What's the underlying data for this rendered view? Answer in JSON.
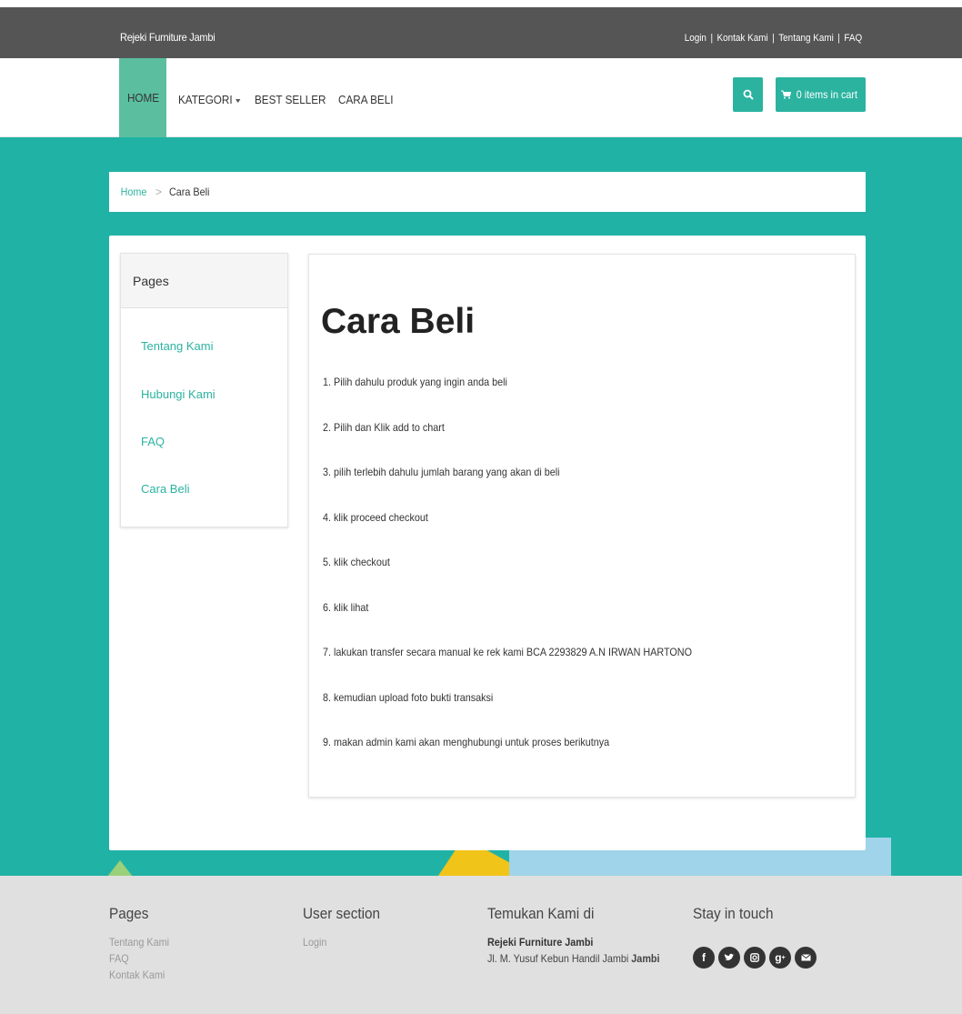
{
  "topbar": {
    "brand": "Rejeki Furniture Jambi",
    "links": [
      "Login",
      "Kontak Kami",
      "Tentang Kami",
      "FAQ"
    ]
  },
  "nav": {
    "items": [
      "HOME",
      "KATEGORI",
      "BEST SELLER",
      "CARA BELI"
    ],
    "cart_label": "0 items in cart"
  },
  "breadcrumb": {
    "home": "Home",
    "separator": ">",
    "current": "Cara Beli"
  },
  "sidebar": {
    "title": "Pages",
    "items": [
      "Tentang Kami",
      "Hubungi Kami",
      "FAQ",
      "Cara Beli"
    ]
  },
  "content": {
    "title": "Cara Beli",
    "steps": [
      "1. Pilih dahulu produk yang ingin anda beli",
      "2. Pilih dan Klik add to chart",
      "3. pilih terlebih dahulu jumlah barang yang akan di beli",
      "4. klik proceed checkout",
      "5. klik checkout",
      "6. klik lihat",
      "7. lakukan transfer secara manual ke rek kami  BCA 2293829 A.N IRWAN HARTONO",
      "8. kemudian upload foto bukti transaksi",
      "9. makan admin kami akan menghubungi untuk proses berikutnya"
    ]
  },
  "footer": {
    "pages": {
      "title": "Pages",
      "links": [
        "Tentang Kami",
        "FAQ",
        "Kontak Kami"
      ]
    },
    "user": {
      "title": "User section",
      "links": [
        "Login"
      ]
    },
    "find": {
      "title": "Temukan Kami di",
      "name": "Rejeki Furniture Jambi",
      "address": "Jl. M. Yusuf Kebun Handil Jambi",
      "city": "Jambi"
    },
    "stay": {
      "title": "Stay in touch",
      "icons": [
        "facebook-icon",
        "twitter-icon",
        "instagram-icon",
        "google-plus-icon",
        "email-icon"
      ]
    }
  },
  "colors": {
    "accent": "#2bb3a0",
    "hero_bg": "#21b2a6",
    "topbar_bg": "#555555",
    "footer_bg": "#e0e0e0",
    "home_active": "#5bbf9f"
  }
}
